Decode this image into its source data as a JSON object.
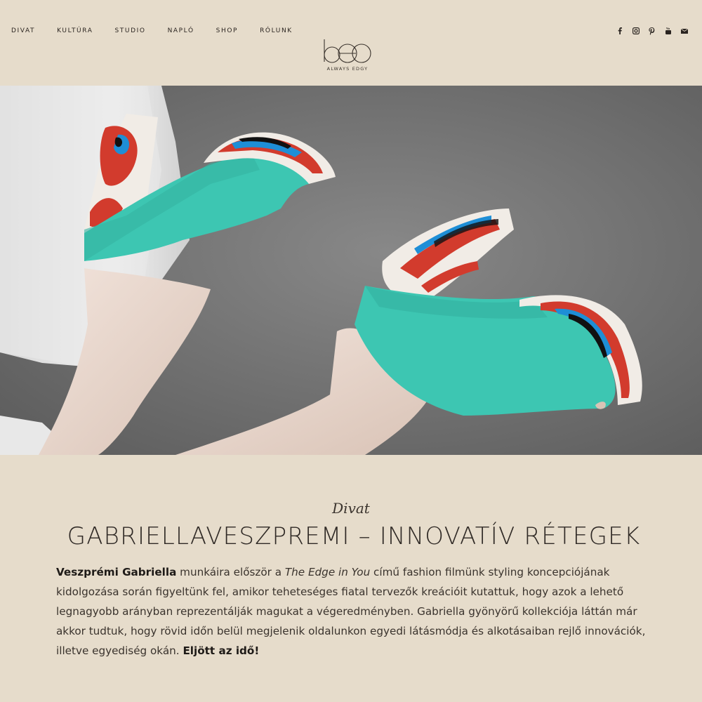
{
  "nav": {
    "items": [
      "DIVAT",
      "KULTÚRA",
      "STUDIO",
      "NAPLÓ",
      "SHOP",
      "RÓLUNK"
    ]
  },
  "logo": {
    "text": "ALWAYS EDGY"
  },
  "social": [
    "facebook-icon",
    "instagram-icon",
    "pinterest-icon",
    "youtube-icon",
    "mail-icon"
  ],
  "article": {
    "category": "Divat",
    "title": "GABRIELLAVESZPREMI – INNOVATÍV RÉTEGEK",
    "intro_bold": "Veszprémi Gabriella",
    "intro_1": " munkáira először a ",
    "intro_italic": "The Edge in You",
    "intro_2": " című fashion filmünk styling koncepciójának kidolgozása során figyeltünk fel, amikor teheteséges fiatal tervezők kreációit kutattuk, hogy azok a lehető legnagyobb arányban reprezentálják magukat a végeredményben. Gabriella gyönyörű kollekciója láttán már akkor tudtuk, hogy rövid időn belül megjelenik oldalunkon egyedi látásmódja és alkotásaiban rejlő innovációk, illetve egyediség okán. ",
    "outro_bold": "Eljött az idő!"
  },
  "colors": {
    "background": "#e6dccb",
    "text": "#2a2420",
    "shoe_turquoise": "#3dc6b2"
  }
}
